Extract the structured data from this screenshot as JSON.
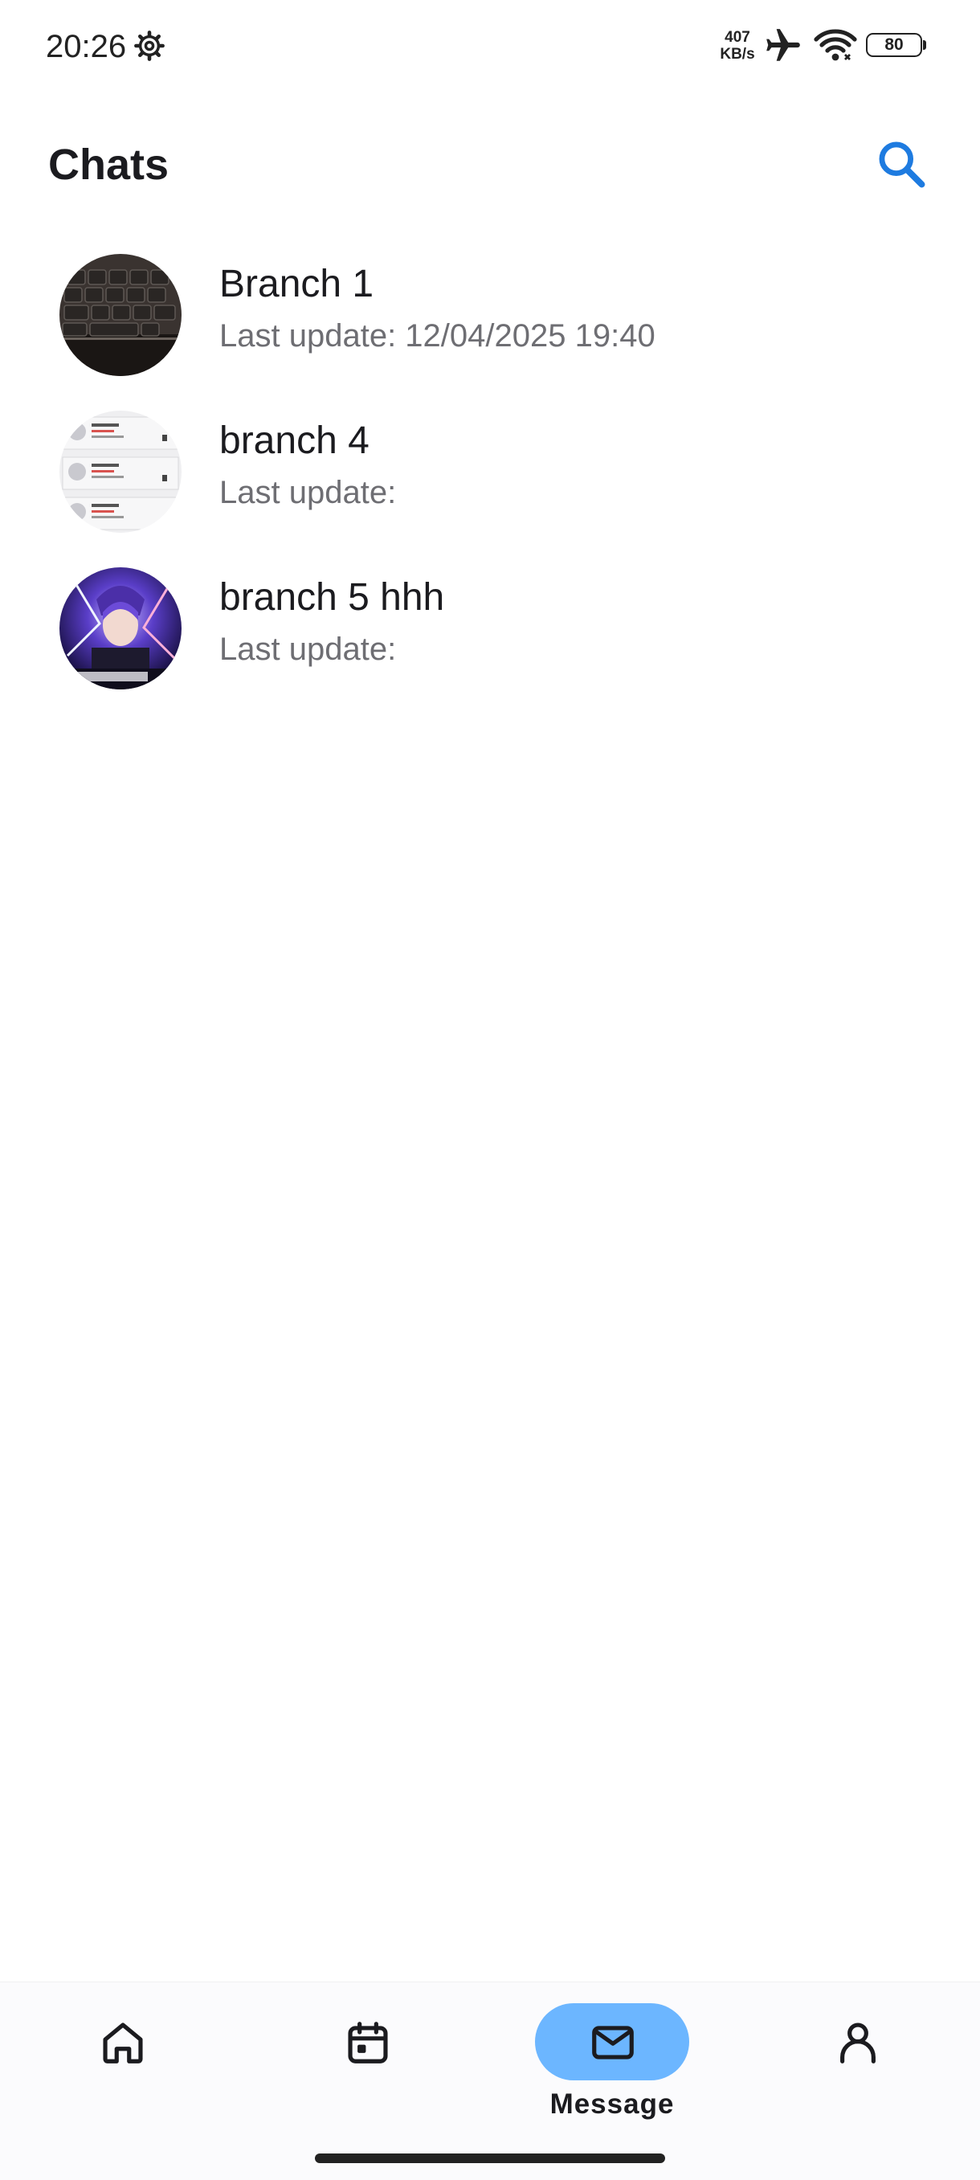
{
  "status_bar": {
    "time": "20:26",
    "net_speed_value": "407",
    "net_speed_unit": "KB/s",
    "battery_level": "80",
    "icons": [
      "gear-icon",
      "airplane-icon",
      "wifi-icon",
      "battery-icon"
    ]
  },
  "header": {
    "title": "Chats",
    "search_icon": "search-icon"
  },
  "chats": [
    {
      "name": "Branch 1",
      "subtitle": "Last update: 12/04/2025 19:40"
    },
    {
      "name": "branch 4",
      "subtitle": "Last update:"
    },
    {
      "name": "branch 5 hhh",
      "subtitle": "Last update:"
    }
  ],
  "bottom_nav": {
    "items": [
      {
        "icon": "home-icon",
        "label": ""
      },
      {
        "icon": "calendar-icon",
        "label": ""
      },
      {
        "icon": "mail-icon",
        "label": "Message",
        "active": true
      },
      {
        "icon": "person-icon",
        "label": ""
      }
    ]
  },
  "colors": {
    "accent": "#1e7be0",
    "active_pill": "#6cb6ff",
    "subtitle": "#6e6e73",
    "text": "#1b1b1f"
  }
}
